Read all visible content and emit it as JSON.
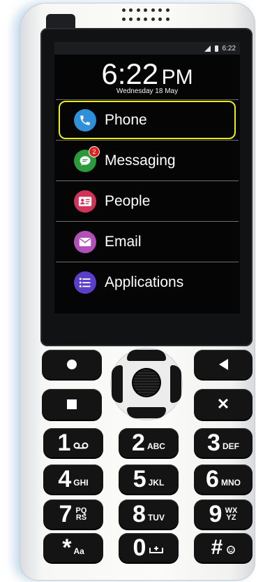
{
  "status_bar": {
    "time": "6:22"
  },
  "clock": {
    "time": "6:22",
    "ampm": "PM",
    "date": "Wednesday 18 May"
  },
  "menu": [
    {
      "label": "Phone",
      "icon": "phone-icon",
      "color": "#2f8fd8",
      "selected": true
    },
    {
      "label": "Messaging",
      "icon": "message-icon",
      "color": "#2a9a3a",
      "badge": "2"
    },
    {
      "label": "People",
      "icon": "contact-card-icon",
      "color": "#d0335a"
    },
    {
      "label": "Email",
      "icon": "envelope-icon",
      "color": "#b34fb8"
    },
    {
      "label": "Applications",
      "icon": "list-icon",
      "color": "#5a3fc9"
    }
  ],
  "keypad": {
    "rows": [
      {
        "num": "1",
        "sub": ""
      },
      {
        "num": "2",
        "sub": "ABC"
      },
      {
        "num": "3",
        "sub": "DEF"
      },
      {
        "num": "4",
        "sub": "GHI"
      },
      {
        "num": "5",
        "sub": "JKL"
      },
      {
        "num": "6",
        "sub": "MNO"
      },
      {
        "num": "7",
        "sub": "PQ RS"
      },
      {
        "num": "8",
        "sub": "TUV"
      },
      {
        "num": "9",
        "sub": "WX YZ"
      },
      {
        "num": "*",
        "sub": "Aa"
      },
      {
        "num": "0",
        "sub": ""
      },
      {
        "num": "#",
        "sub": ""
      }
    ]
  },
  "highlight_color": "#e9ec17"
}
